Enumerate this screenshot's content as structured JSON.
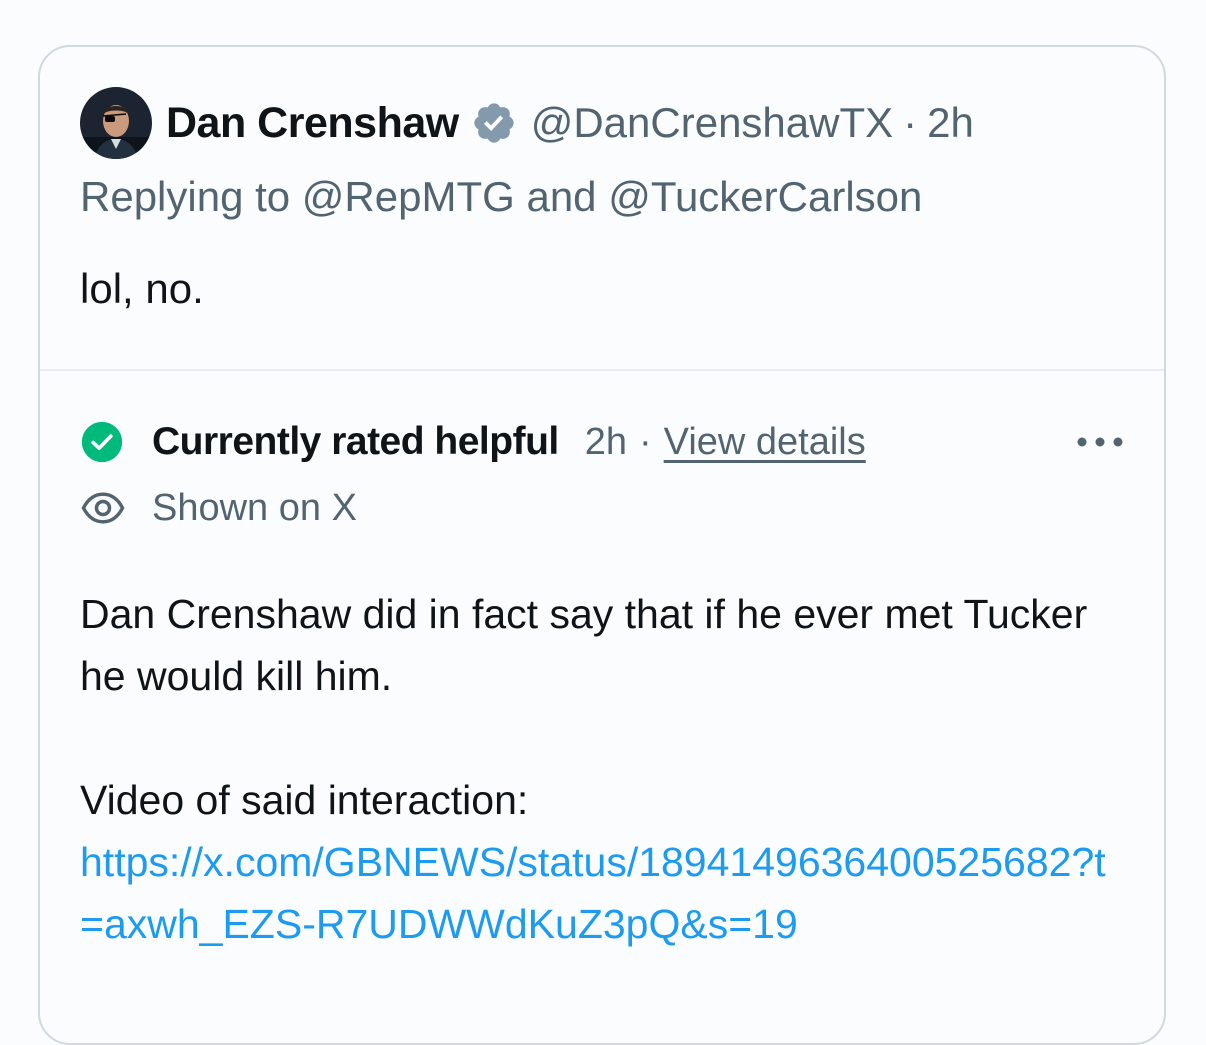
{
  "tweet": {
    "author_name": "Dan Crenshaw",
    "handle": "@DanCrenshawTX",
    "separator": "·",
    "time": "2h",
    "reply_prefix": "Replying to",
    "reply_user_1": "@RepMTG",
    "reply_and": "and",
    "reply_user_2": "@TuckerCarlson",
    "text": "lol, no."
  },
  "note": {
    "status_label": "Currently rated helpful",
    "status_time": "2h",
    "separator": "·",
    "view_details": "View details",
    "shown_label": "Shown on X",
    "body_line_1": "Dan Crenshaw did in fact say that if he ever met Tucker he would kill him.",
    "body_line_2": "Video of said interaction:",
    "link": "https://x.com/GBNEWS/status/1894149636400525682?t=axwh_EZS-R7UDWWdKuZ3pQ&s=19"
  },
  "colors": {
    "verified_badge": "#829aab",
    "helpful_green": "#00ba7c",
    "link_blue": "#1d9bf0",
    "secondary_text": "#536471"
  },
  "icons": {
    "verified": "verified-badge-icon",
    "helpful": "check-circle-icon",
    "shown": "eye-icon",
    "more": "more-horizontal-icon"
  }
}
